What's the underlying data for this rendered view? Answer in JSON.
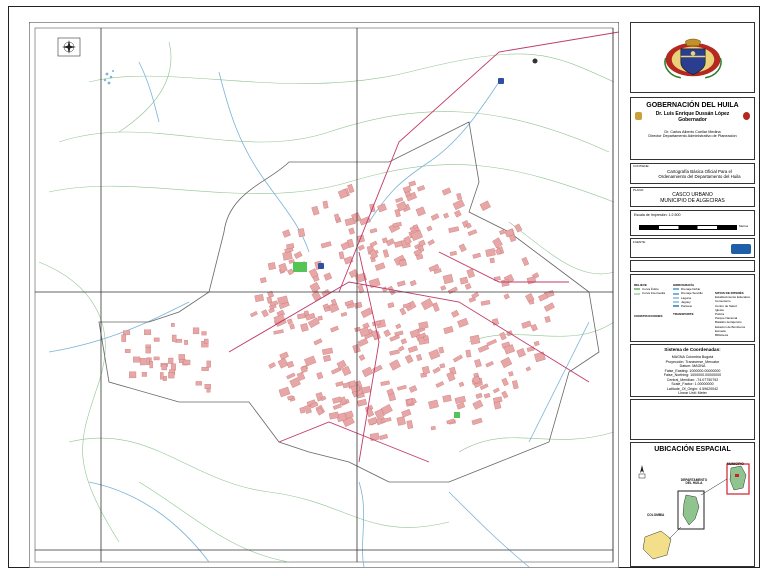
{
  "title_block": {
    "org": "GOBERNACIÓN DEL HUILA",
    "governor_name": "Dr. Luis Enrique Dussán López",
    "governor_role": "Gobernador",
    "director_name": "Dr. Carlos Alberto Cuellar Medina",
    "director_role": "Director Departamento Administrativo de Planeación",
    "contents_label": "CONTIENE:",
    "contents_text": "Cartografía Básica Oficial Para el Ordenamiento del Departamento del Huila",
    "plano_label": "PLANO:",
    "plano_line1": "CASCO URBANO",
    "plano_line2": "MUNICIPIO DE ALGECIRAS",
    "scale_label": "Escala de Impresión: 1:2.500",
    "scale_unit": "Metros",
    "source_label": "FUENTE:",
    "legend_label": "CONVENCIONES",
    "coord_title": "Sistema de Coordenadas:",
    "coord_lines": [
      "MAGNA Colombia Bogotá",
      "Proyección: Transverse_Mercator",
      "Datum: MAGNA",
      "False_Easting: 1000000.00000000",
      "False_Northing: 1000000.00000000",
      "Central_Meridian: -74.07750792",
      "Scale_Factor: 1.00000000",
      "Latitude_Of_Origin: 4.59620042",
      "Linear Unit: Meter"
    ],
    "location_title": "UBICACIÓN ESPACIAL",
    "loc_colombia": "COLOMBIA",
    "loc_departamento": "DEPARTAMENTO DEL HUILA",
    "loc_municipio": "MUNICIPIO"
  },
  "legend": {
    "relieve_title": "RELIEVE",
    "relieve_items": [
      "Curva Índice",
      "Curva Intermedia"
    ],
    "hidro_title": "HIDROGRAFÍA",
    "hidro_items": [
      "Drenaje Doble",
      "Drenaje Sencillo",
      "Laguna",
      "Jagüey",
      "Pantano"
    ],
    "construcciones_title": "CONSTRUCCIONES",
    "transporte_title": "TRANSPORTE",
    "sitios_title": "SITIOS DE INTERÉS",
    "sitios_items": [
      "Establecimiento Educativo",
      "Cementerio",
      "Centro de Salud",
      "Iglesia",
      "Policía",
      "Parque Nacional",
      "Batallón del Ejército",
      "Estación de Bomberos",
      "Escuela",
      "Biblioteca"
    ]
  },
  "colors": {
    "urban_block": "#e8a7a7",
    "road_main": "#c03a6a",
    "drainage": "#7ab3d8",
    "contour": "#8fc48f",
    "perimeter": "#666666",
    "park": "#55c455",
    "location_highlight": "#d11f2a"
  },
  "icons": [
    "north-arrow-icon",
    "coat-of-arms-icon",
    "highway-shield-icon"
  ]
}
